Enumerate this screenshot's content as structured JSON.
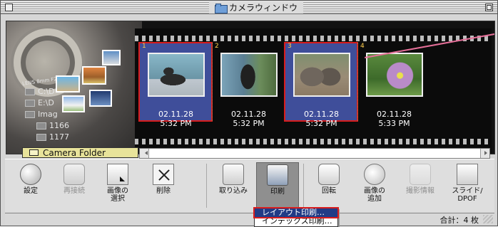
{
  "window": {
    "title": "カメラウィンドウ"
  },
  "sidebar": {
    "lens_text": "LENS 8mm F2.5",
    "drives": [
      {
        "label": "C:\\D"
      },
      {
        "label": "E:\\D"
      },
      {
        "label": "Imag"
      },
      {
        "label": "1166"
      },
      {
        "label": "1177"
      }
    ],
    "folder_label": "Camera Folder"
  },
  "film": {
    "frames": [
      {
        "number": "1",
        "date": "02.11.28",
        "time": "5:32 PM",
        "selected": true,
        "subject": "sea lion"
      },
      {
        "number": "2",
        "date": "02.11.28",
        "time": "5:32 PM",
        "selected": false,
        "subject": "sea lion"
      },
      {
        "number": "3",
        "date": "02.11.28",
        "time": "5:32 PM",
        "selected": true,
        "subject": "elephants"
      },
      {
        "number": "4",
        "date": "02.11.28",
        "time": "5:33 PM",
        "selected": false,
        "subject": "flower"
      }
    ]
  },
  "toolbar": {
    "buttons": [
      {
        "label": "設定",
        "disabled": false,
        "icon": "settings-icon"
      },
      {
        "label": "再接続",
        "disabled": true,
        "icon": "reconnect-icon"
      },
      {
        "label": "画像の\n選択",
        "disabled": false,
        "icon": "select-image-icon"
      },
      {
        "label": "削除",
        "disabled": false,
        "icon": "delete-icon"
      },
      {
        "label": "取り込み",
        "disabled": false,
        "icon": "import-icon"
      },
      {
        "label": "印刷",
        "disabled": false,
        "icon": "print-icon"
      },
      {
        "label": "回転",
        "disabled": false,
        "icon": "rotate-icon"
      },
      {
        "label": "画像の\n追加",
        "disabled": false,
        "icon": "add-image-icon"
      },
      {
        "label": "撮影情報",
        "disabled": true,
        "icon": "shooting-info-icon"
      },
      {
        "label": "スライド/\nDPOF",
        "disabled": false,
        "icon": "slideshow-icon"
      }
    ]
  },
  "status": {
    "total": "合計：4 枚"
  },
  "print_menu": {
    "items": [
      {
        "label": "レイアウト印刷…"
      },
      {
        "label": "インデックス印刷…"
      }
    ]
  }
}
